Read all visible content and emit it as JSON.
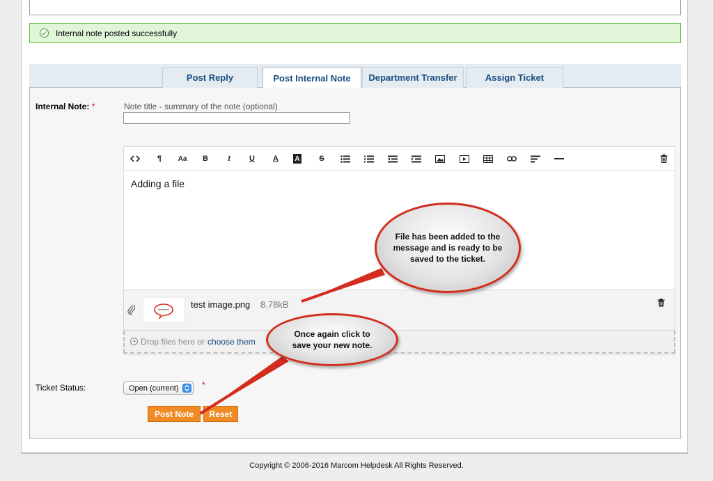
{
  "alert": {
    "success_message": "Internal note posted successfully"
  },
  "tabs": [
    {
      "label": "Post Reply"
    },
    {
      "label": "Post Internal Note"
    },
    {
      "label": "Department Transfer"
    },
    {
      "label": "Assign Ticket"
    }
  ],
  "form": {
    "internal_note_label": "Internal Note:",
    "required_mark": "*",
    "title_hint": "Note title - summary of the note (optional)",
    "title_value": "",
    "editor_body": "Adding a file",
    "attachment": {
      "file_name": "test image.png",
      "file_size": "8.78kB"
    },
    "dropzone_text": "Drop files here or",
    "dropzone_link": "choose them",
    "ticket_status_label": "Ticket Status:",
    "ticket_status_value": "Open (current)",
    "post_button": "Post Note",
    "reset_button": "Reset"
  },
  "toolbar": {
    "icons": [
      "code-view-icon",
      "paragraph-icon",
      "font-size-icon",
      "bold-icon",
      "italic-icon",
      "underline-icon",
      "font-color-icon",
      "background-color-icon",
      "strikethrough-icon",
      "unordered-list-icon",
      "ordered-list-icon",
      "outdent-icon",
      "indent-icon",
      "image-icon",
      "video-icon",
      "table-icon",
      "link-icon",
      "align-icon",
      "horizontal-rule-icon",
      "trash-icon"
    ],
    "labels": {
      "font_size": "Aa",
      "bold": "B",
      "italic": "I",
      "underline": "U",
      "font_color": "A",
      "bg_color": "A",
      "strike": "S",
      "paragraph": "¶"
    }
  },
  "callouts": {
    "file_added": "File has been added to the message and is ready to be saved to the ticket.",
    "click_save": "Once again click to save your new note."
  },
  "colors": {
    "accent_button": "#f08a24",
    "callout_border": "#d22d1e",
    "tab_text": "#184e81",
    "success_bg": "#e1f5d9"
  },
  "footer": {
    "copyright": "Copyright © 2006-2016 Marcom Helpdesk All Rights Reserved."
  }
}
